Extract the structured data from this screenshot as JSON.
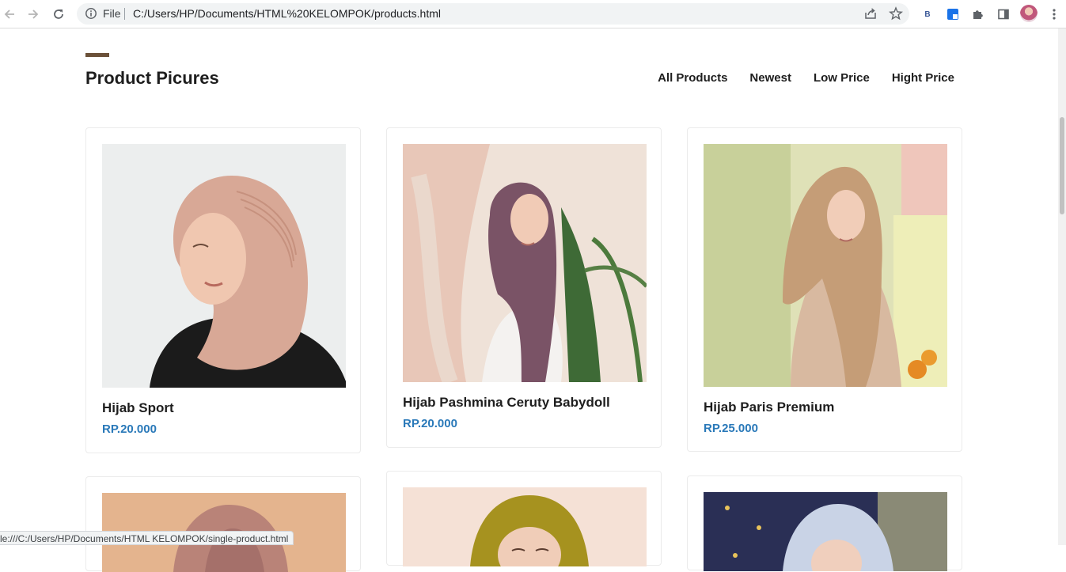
{
  "browser": {
    "scheme": "File",
    "url": "C:/Users/HP/Documents/HTML%20KELOMPOK/products.html",
    "extension_badge": "B",
    "status_url": "le:///C:/Users/HP/Documents/HTML KELOMPOK/single-product.html"
  },
  "section": {
    "title": "Product Picures",
    "accent_color": "#6b5139"
  },
  "filters": [
    "All Products",
    "Newest",
    "Low Price",
    "Hight Price"
  ],
  "products": [
    {
      "name": "Hijab Sport",
      "price": "RP.20.000"
    },
    {
      "name": "Hijab Pashmina Ceruty Babydoll",
      "price": "RP.20.000"
    },
    {
      "name": "Hijab Paris Premium",
      "price": "RP.25.000"
    }
  ],
  "colors": {
    "price": "#2a79b9",
    "text": "#1e1e1e"
  }
}
